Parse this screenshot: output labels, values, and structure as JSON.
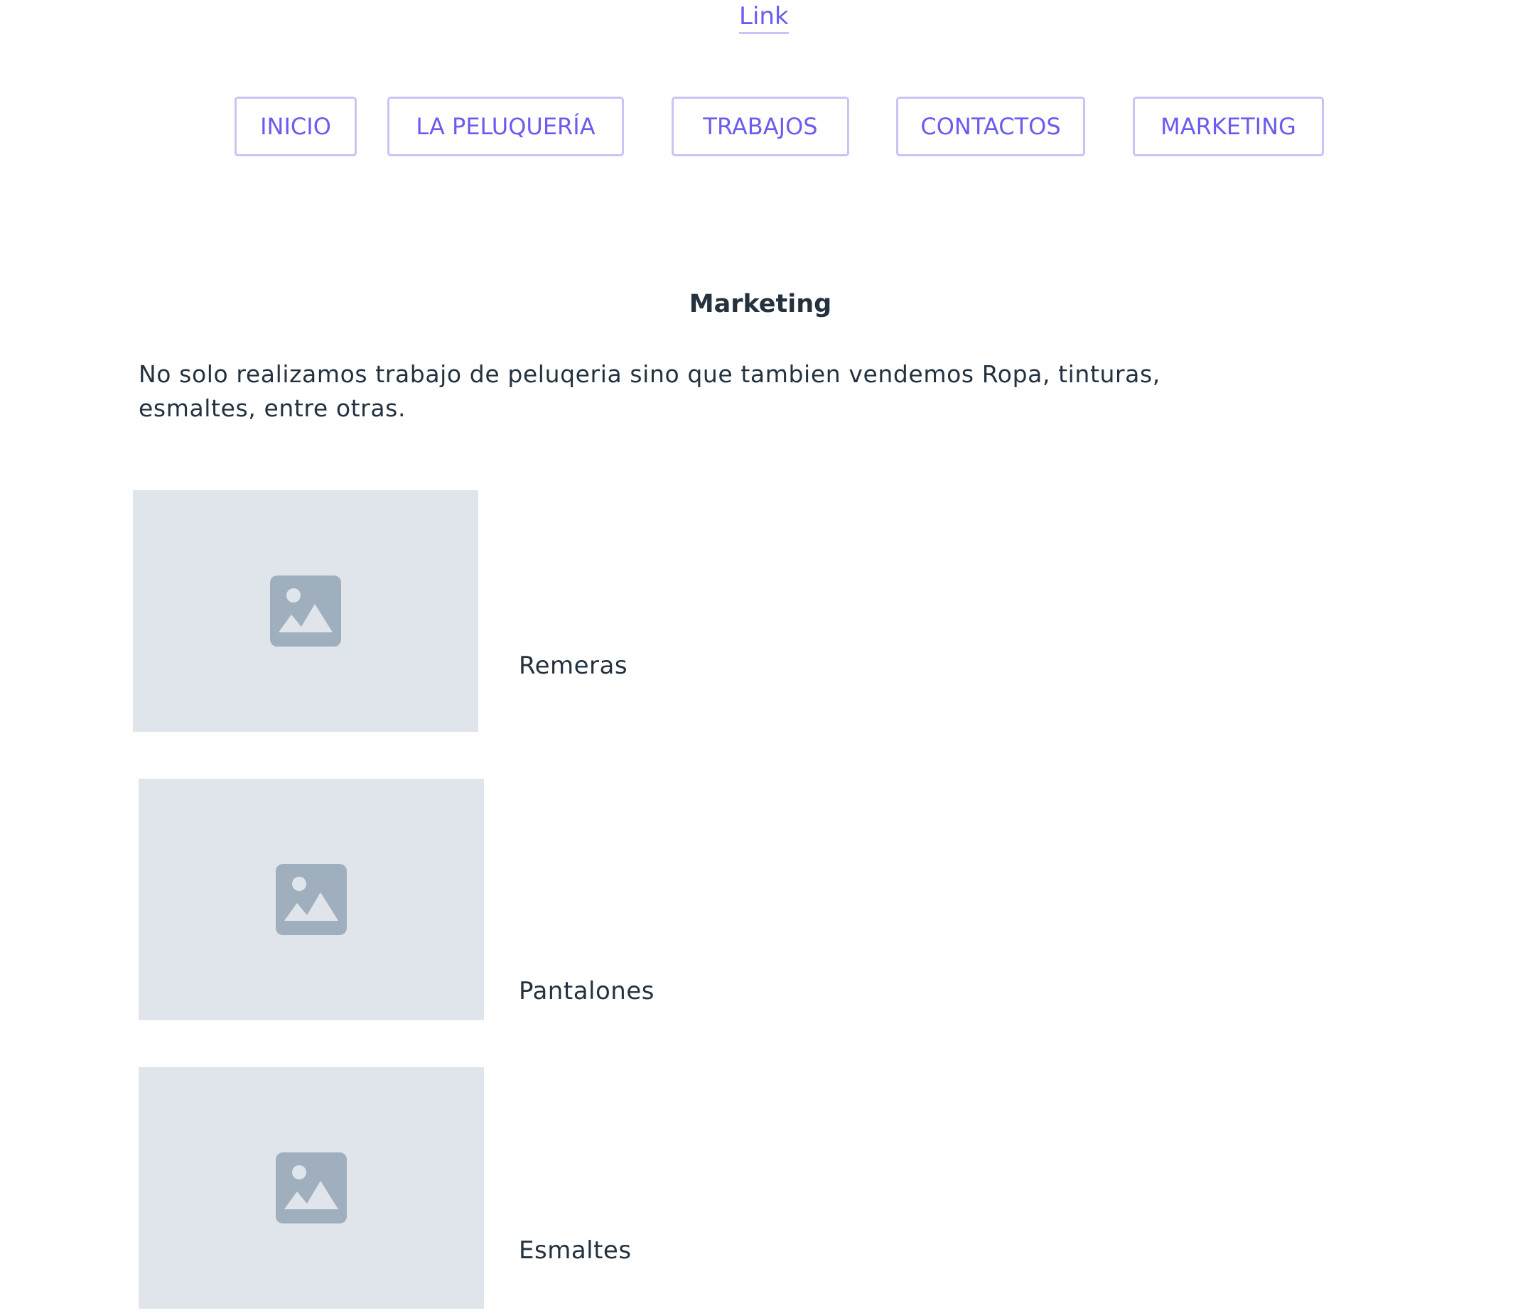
{
  "header": {
    "link_text": "Link"
  },
  "nav": {
    "items": [
      {
        "label": "INICIO"
      },
      {
        "label": "LA PELUQUERÍA"
      },
      {
        "label": "TRABAJOS"
      },
      {
        "label": "CONTACTOS"
      },
      {
        "label": "MARKETING"
      }
    ]
  },
  "main": {
    "title": "Marketing",
    "intro": "No solo realizamos trabajo de peluqeria sino que tambien vendemos Ropa, tinturas, esmaltes, entre otras.",
    "products": [
      {
        "label": "Remeras",
        "image_icon": "image-placeholder-icon"
      },
      {
        "label": "Pantalones",
        "image_icon": "image-placeholder-icon"
      },
      {
        "label": "Esmaltes",
        "image_icon": "image-placeholder-icon"
      }
    ]
  },
  "colors": {
    "accent": "#6b5cf0",
    "button_border": "#cbc3f5",
    "placeholder_bg": "#e0e5ec",
    "placeholder_icon": "#a0afbd",
    "text": "#24323f"
  }
}
